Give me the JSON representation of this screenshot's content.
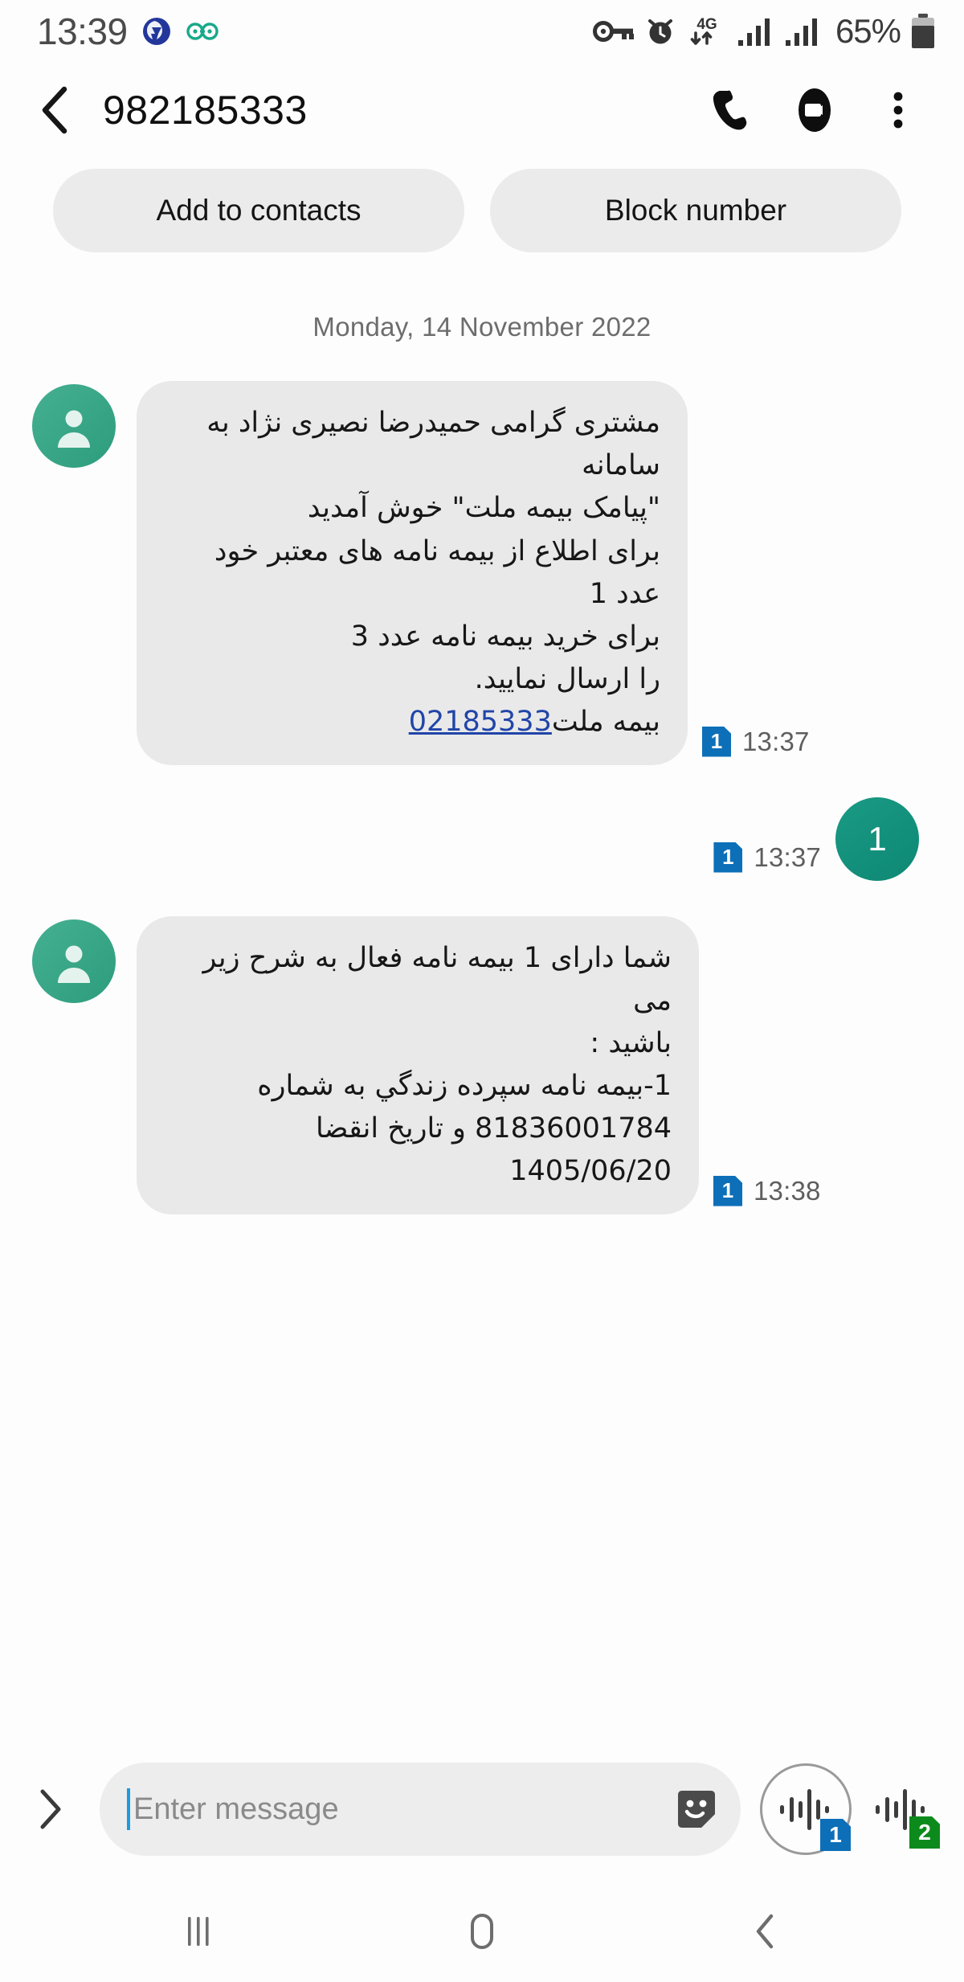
{
  "status_bar": {
    "clock": "13:39",
    "battery_percent": "65%",
    "network": "4G",
    "icons": [
      "app-notification-icon-blue",
      "app-notification-icon-teal",
      "vpn-key-icon",
      "alarm-clock-icon",
      "mobile-data-icon",
      "signal-sim1-icon",
      "signal-sim2-icon",
      "battery-icon"
    ]
  },
  "header": {
    "title": "982185333",
    "back_icon": "back-chevron-icon",
    "call_icon": "phone-call-icon",
    "video_icon": "video-call-icon",
    "more_icon": "more-options-icon"
  },
  "action_chips": {
    "add_to_contacts": "Add to contacts",
    "block_number": "Block number"
  },
  "conversation": {
    "date_separator": "Monday, 14 November 2022",
    "messages": [
      {
        "direction": "incoming",
        "sim": "1",
        "time": "13:37",
        "avatar_icon": "contact-avatar-icon",
        "lines": [
          "مشتری گرامی حمیدرضا نصیری نژاد به سامانه",
          "\"پیامک بیمه ملت\" خوش آمدید",
          "برای اطلاع از بیمه نامه های معتبر خود عدد 1",
          "برای خرید بیمه نامه عدد 3",
          "را ارسال نمایید."
        ],
        "last_line_prefix": "بیمه ملت",
        "link": "02185333"
      },
      {
        "direction": "outgoing",
        "sim": "1",
        "time": "13:37",
        "text": "1"
      },
      {
        "direction": "incoming",
        "sim": "1",
        "time": "13:38",
        "avatar_icon": "contact-avatar-icon",
        "lines": [
          "شما دارای 1 بیمه نامه فعال به شرح زیر می",
          "باشید :",
          "1-بیمه نامه سپرده زندگي به شماره",
          "81836001784 و تاریخ انقضا 1405/06/20"
        ]
      }
    ]
  },
  "composer": {
    "expand_icon": "expand-chevron-icon",
    "placeholder": "Enter message",
    "value": "",
    "sticker_icon": "sticker-icon",
    "send_sim1_icon": "voice-send-sim1-icon",
    "send_sim1_badge": "1",
    "send_sim2_icon": "voice-send-sim2-icon",
    "send_sim2_badge": "2"
  },
  "nav_bar": {
    "recents_icon": "recents-icon",
    "home_icon": "home-icon",
    "back_icon": "nav-back-icon"
  },
  "colors": {
    "accent_green": "#11917c",
    "avatar_green": "#36a887",
    "sim1_blue": "#0d6fb8",
    "sim2_green": "#0e8a22",
    "bubble_gray": "#e9e9e9",
    "chip_gray": "#ebebeb",
    "link_blue": "#2145a8"
  }
}
